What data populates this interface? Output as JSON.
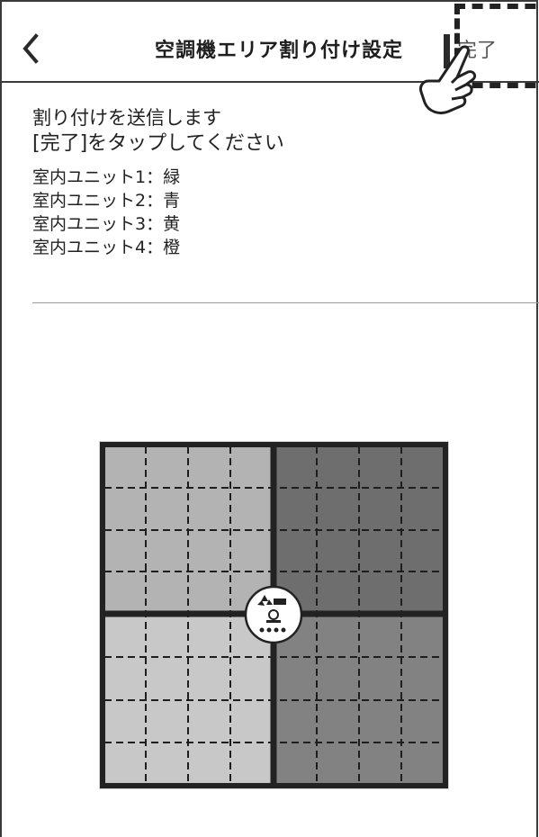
{
  "header": {
    "title": "空調機エリア割り付け設定",
    "done_label": "完了",
    "back_icon": "chevron-left-icon"
  },
  "message": {
    "line1": "割り付けを送信します",
    "line2": "[完了]をタップしてください"
  },
  "units": [
    {
      "label": "室内ユニット1：緑"
    },
    {
      "label": "室内ユニット2：青"
    },
    {
      "label": "室内ユニット3：黄"
    },
    {
      "label": "室内ユニット4：橙"
    }
  ],
  "area_map": {
    "quadrant_colors": {
      "top_left": "#b3b3b3",
      "top_right": "#6e6e6e",
      "bottom_left": "#c8c8c8",
      "bottom_right": "#828282"
    },
    "center_device_icon": "ceiling-unit-sensor-icon"
  }
}
